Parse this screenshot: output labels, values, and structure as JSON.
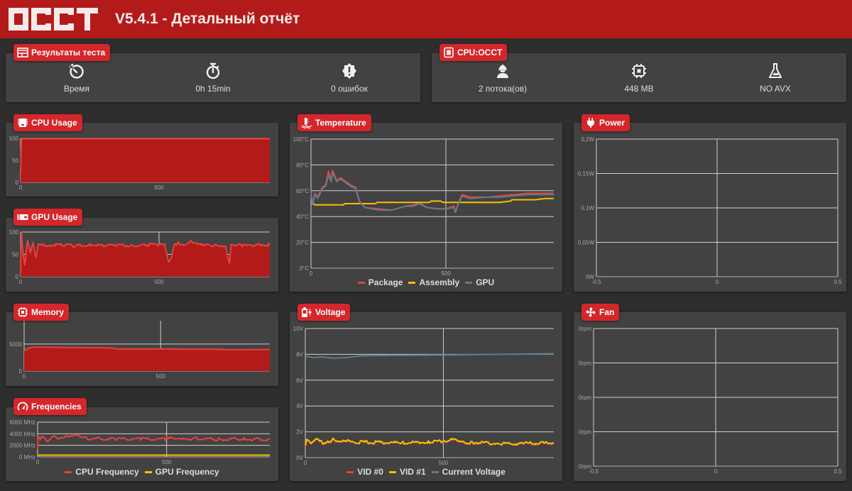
{
  "header": {
    "logo": "OCCT",
    "title": "V5.4.1 - Детальный отчёт"
  },
  "results": {
    "badge": "Результаты теста",
    "stats": [
      {
        "icon": "clock-rotate-icon",
        "label": "Время"
      },
      {
        "icon": "stopwatch-icon",
        "label": "0h 15min"
      },
      {
        "icon": "error-badge-icon",
        "label": "0 ошибок"
      }
    ]
  },
  "cpu_occt": {
    "badge": "CPU:OCCT",
    "stats": [
      {
        "icon": "worker-icon",
        "label": "2 потока(ов)"
      },
      {
        "icon": "chip-icon",
        "label": "448 MB"
      },
      {
        "icon": "flask-icon",
        "label": "NO AVX"
      }
    ]
  },
  "panels": {
    "cpu_usage": "CPU Usage",
    "gpu_usage": "GPU Usage",
    "memory": "Memory",
    "frequencies": "Frequencies",
    "temperature": "Temperature",
    "voltage": "Voltage",
    "power": "Power",
    "fan": "Fan"
  },
  "colors": {
    "accent": "#d3272b",
    "header": "#b31b1b",
    "fill": "#b31b1b",
    "red_line": "#e8413e",
    "yellow": "#f5c000",
    "blue_grey": "#5e7c8c"
  },
  "chart_data": [
    {
      "id": "cpu_usage",
      "type": "area",
      "title": "CPU Usage",
      "xlim": [
        0,
        900
      ],
      "ylim": [
        0,
        100
      ],
      "yticks": [
        "0",
        "50",
        "100"
      ],
      "xticks": [
        "0",
        "500"
      ],
      "series": [
        {
          "name": "CPU Usage",
          "x": [
            0,
            3,
            10,
            900
          ],
          "values": [
            20,
            99,
            99,
            99
          ]
        }
      ]
    },
    {
      "id": "gpu_usage",
      "type": "area",
      "title": "GPU Usage",
      "xlim": [
        0,
        900
      ],
      "ylim": [
        0,
        100
      ],
      "yticks": [
        "0",
        "50",
        "100"
      ],
      "xticks": [
        "0",
        "500"
      ],
      "series": [
        {
          "name": "GPU Usage",
          "x": [
            0,
            3,
            8,
            15,
            25,
            35,
            45,
            55,
            65,
            80,
            100,
            150,
            200,
            250,
            300,
            350,
            400,
            450,
            500,
            520,
            535,
            545,
            555,
            570,
            590,
            620,
            640,
            660,
            700,
            740,
            750,
            755,
            760,
            800,
            850,
            900
          ],
          "values": [
            10,
            98,
            55,
            25,
            80,
            50,
            75,
            40,
            72,
            70,
            70,
            71,
            69,
            72,
            70,
            71,
            70,
            71,
            72,
            70,
            30,
            40,
            70,
            76,
            72,
            80,
            72,
            70,
            70,
            70,
            40,
            33,
            72,
            70,
            71,
            72
          ]
        }
      ]
    },
    {
      "id": "memory",
      "type": "area",
      "title": "Memory",
      "xlim": [
        0,
        900
      ],
      "ylim": [
        0,
        8000
      ],
      "yticks": [
        "0",
        "5000"
      ],
      "xticks": [
        "0",
        "500"
      ],
      "series": [
        {
          "name": "Memory",
          "x": [
            0,
            15,
            30,
            100,
            200,
            300,
            330,
            335,
            500,
            600,
            700,
            750,
            800,
            900
          ],
          "values": [
            3800,
            4200,
            4400,
            4400,
            4350,
            4300,
            4250,
            4100,
            4100,
            4050,
            4050,
            3950,
            3950,
            4000
          ]
        }
      ]
    },
    {
      "id": "frequencies",
      "type": "line",
      "title": "Frequencies",
      "xlim": [
        0,
        900
      ],
      "ylim": [
        0,
        6000
      ],
      "yticks": [
        "0 MHz",
        "2000 MHz",
        "4000 MHz",
        "6000 MHz"
      ],
      "xticks": [
        "0",
        "500"
      ],
      "series": [
        {
          "name": "CPU Frequency",
          "x": [
            0,
            2,
            10,
            20,
            40,
            60,
            90,
            120,
            150,
            170,
            200,
            300,
            400,
            500,
            550,
            560,
            600,
            700,
            800,
            900
          ],
          "values": [
            1500,
            3600,
            3000,
            3700,
            2800,
            3800,
            3000,
            3700,
            3700,
            3300,
            3200,
            3100,
            3100,
            3100,
            3400,
            3000,
            3200,
            3000,
            3100,
            3000
          ]
        },
        {
          "name": "GPU Frequency",
          "x": [
            0,
            900
          ],
          "values": [
            300,
            300
          ]
        }
      ]
    },
    {
      "id": "temperature",
      "type": "line",
      "title": "Temperature",
      "xlim": [
        0,
        900
      ],
      "ylim": [
        0,
        100
      ],
      "yticks": [
        "0°C",
        "20°C",
        "40°C",
        "60°C",
        "80°C",
        "100°C"
      ],
      "xticks": [
        "0",
        "500"
      ],
      "series": [
        {
          "name": "Package",
          "x": [
            0,
            5,
            15,
            25,
            40,
            55,
            65,
            75,
            80,
            95,
            110,
            150,
            165,
            180,
            200,
            250,
            300,
            350,
            380,
            400,
            430,
            470,
            500,
            530,
            535,
            545,
            560,
            590,
            650,
            700,
            750,
            800,
            900
          ],
          "values": [
            60,
            50,
            58,
            55,
            62,
            65,
            75,
            68,
            76,
            68,
            70,
            64,
            63,
            52,
            47,
            46,
            45,
            48,
            49,
            51,
            47,
            46,
            46,
            48,
            43,
            50,
            57,
            55,
            55,
            56,
            57,
            58,
            58
          ]
        },
        {
          "name": "Assembly",
          "x": [
            0,
            15,
            120,
            125,
            240,
            245,
            440,
            445,
            480,
            490,
            560,
            700,
            740,
            745,
            830,
            870,
            900
          ],
          "values": [
            52,
            49,
            49,
            50,
            50,
            51,
            51,
            52,
            52,
            51,
            51,
            51,
            52,
            53,
            53,
            54,
            54
          ]
        },
        {
          "name": "GPU",
          "x": [
            0,
            5,
            15,
            25,
            40,
            55,
            65,
            75,
            80,
            95,
            110,
            150,
            165,
            180,
            200,
            250,
            300,
            350,
            380,
            400,
            430,
            470,
            500,
            530,
            535,
            545,
            560,
            590,
            650,
            700,
            750,
            800,
            900
          ],
          "values": [
            59,
            49,
            57,
            54,
            61,
            64,
            72,
            67,
            74,
            67,
            69,
            63,
            62,
            51,
            47,
            45,
            45,
            48,
            48,
            50,
            47,
            46,
            46,
            47,
            43,
            49,
            56,
            54,
            55,
            55,
            56,
            57,
            57
          ]
        }
      ]
    },
    {
      "id": "voltage",
      "type": "line",
      "title": "Voltage",
      "xlim": [
        0,
        900
      ],
      "ylim": [
        0,
        10
      ],
      "yticks": [
        "0V",
        "2V",
        "4V",
        "6V",
        "8V",
        "10V"
      ],
      "xticks": [
        "0",
        "500"
      ],
      "series": [
        {
          "name": "VID #0",
          "x": [
            0,
            5,
            20,
            40,
            70,
            100,
            130,
            160,
            180,
            250,
            350,
            450,
            540,
            560,
            600,
            700,
            800,
            900
          ],
          "values": [
            0.9,
            1.3,
            1.0,
            1.35,
            1.0,
            1.35,
            1.3,
            1.35,
            1.2,
            1.15,
            1.15,
            1.2,
            1.35,
            1.1,
            1.15,
            1.1,
            1.05,
            1.1
          ]
        },
        {
          "name": "VID #1",
          "x": [
            0,
            5,
            20,
            40,
            70,
            100,
            130,
            160,
            180,
            250,
            350,
            450,
            540,
            560,
            600,
            700,
            800,
            900
          ],
          "values": [
            1.0,
            1.35,
            1.05,
            1.4,
            1.05,
            1.4,
            1.35,
            1.4,
            1.2,
            1.2,
            1.15,
            1.2,
            1.4,
            1.15,
            1.2,
            1.1,
            1.1,
            1.15
          ]
        },
        {
          "name": "Current Voltage",
          "x": [
            0,
            30,
            60,
            100,
            150,
            200,
            300,
            500,
            700,
            900
          ],
          "values": [
            7.85,
            7.75,
            7.8,
            7.7,
            7.75,
            7.88,
            7.92,
            7.95,
            8.0,
            8.05
          ]
        }
      ]
    },
    {
      "id": "power",
      "type": "line",
      "title": "Power",
      "xlim": [
        -0.5,
        0.5
      ],
      "ylim": [
        0,
        0.2
      ],
      "yticks": [
        "0W",
        "0,05W",
        "0,1W",
        "0,15W",
        "0,2W"
      ],
      "xticks": [
        "-0.5",
        "0",
        "0.5"
      ],
      "series": []
    },
    {
      "id": "fan",
      "type": "line",
      "title": "Fan",
      "xlim": [
        -0.5,
        0.5
      ],
      "ylim": [
        0,
        4
      ],
      "yticks": [
        "0rpm",
        "0rpm",
        "0rpm",
        "0rpm",
        "0rpm"
      ],
      "xticks": [
        "-0.5",
        "0",
        "0.5"
      ],
      "series": []
    }
  ]
}
